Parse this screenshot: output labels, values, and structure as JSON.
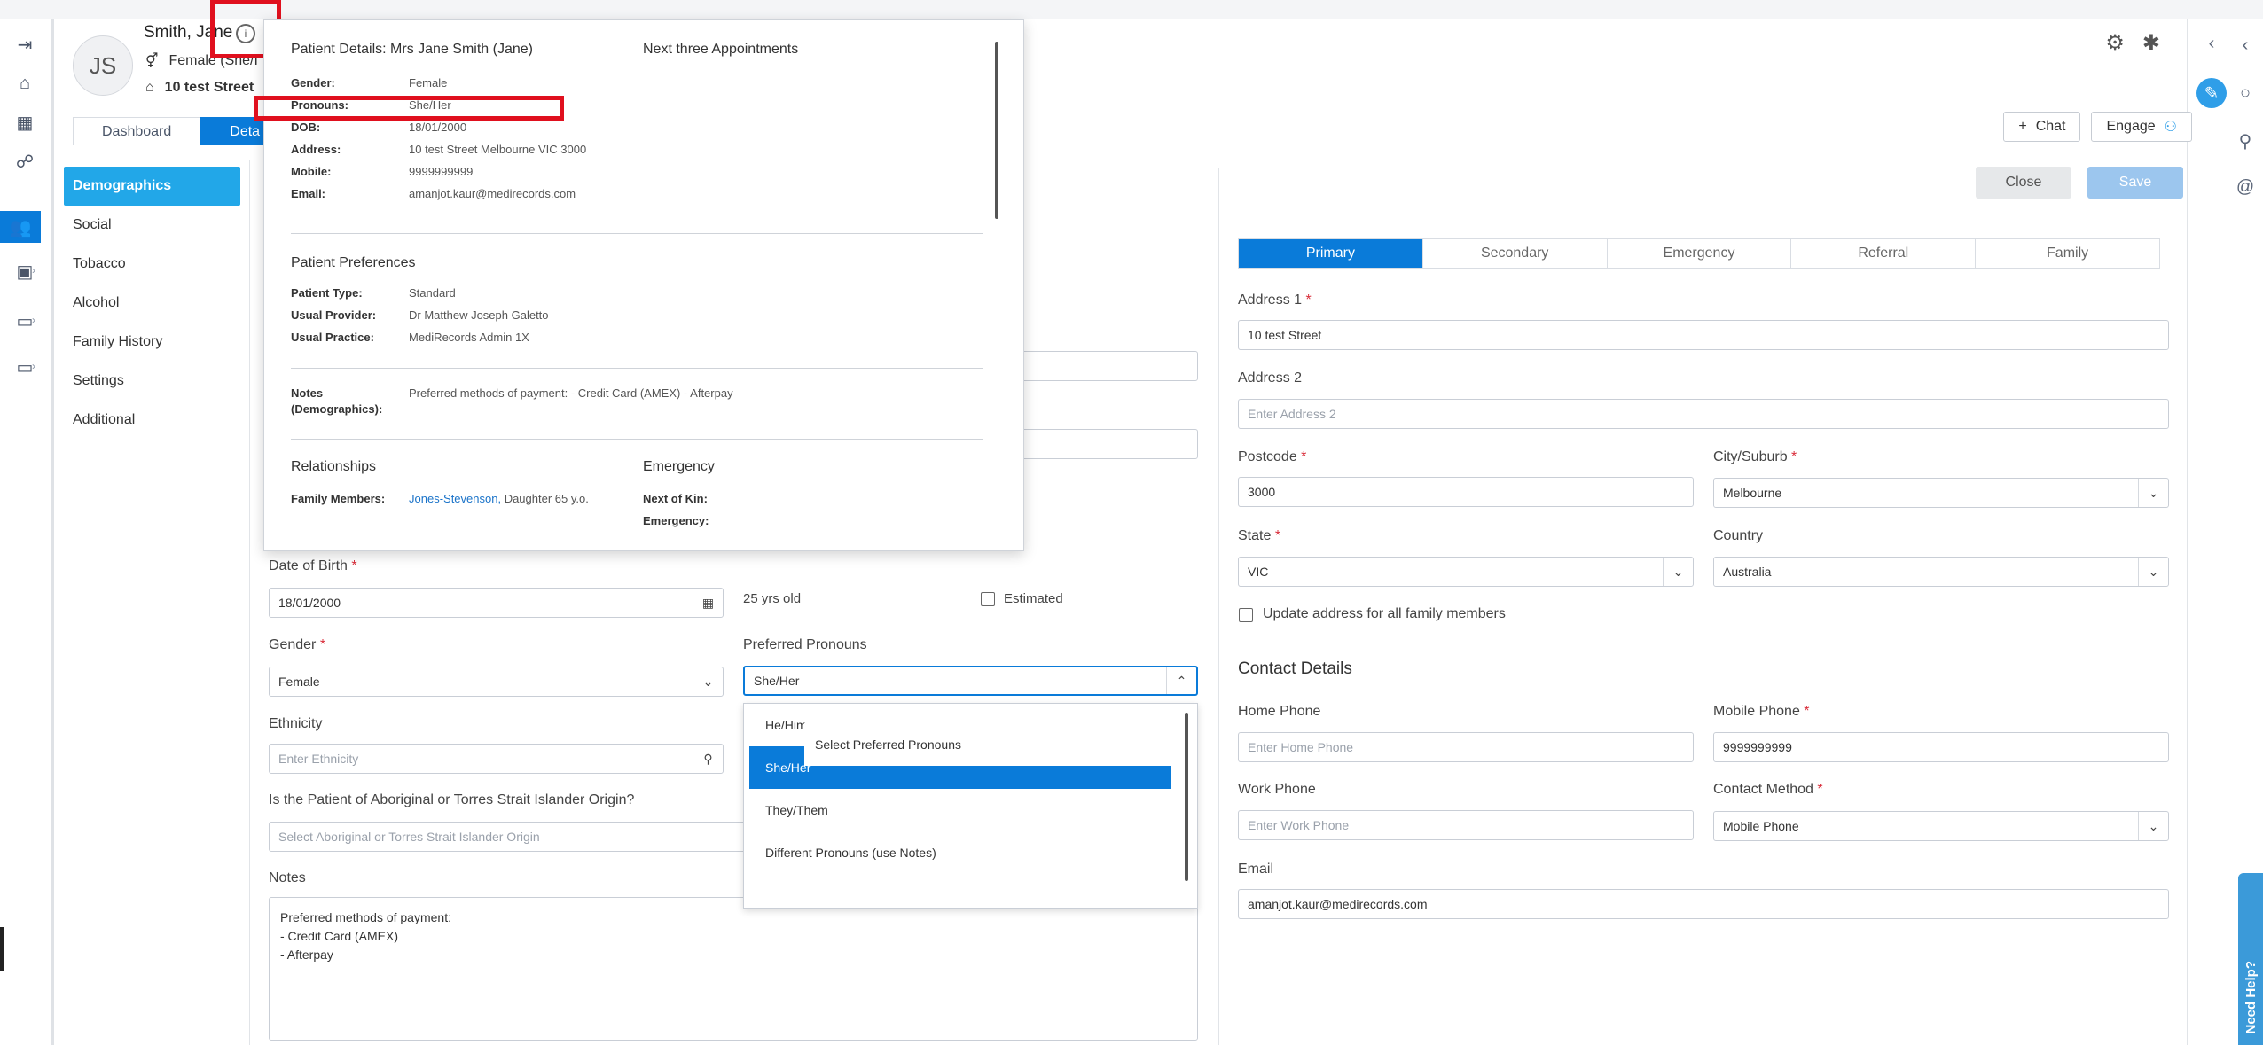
{
  "patient": {
    "name": "Smith, Jane",
    "initials": "JS",
    "gender_line": "Female (She/I",
    "address_line": "10 test Street"
  },
  "tabs": {
    "dashboard": "Dashboard",
    "details": "Deta"
  },
  "header_buttons": {
    "chat": "Chat",
    "engage": "Engage"
  },
  "actions": {
    "close": "Close",
    "save": "Save"
  },
  "sidenav": [
    "Demographics",
    "Social",
    "Tobacco",
    "Alcohol",
    "Family History",
    "Settings",
    "Additional"
  ],
  "popover": {
    "title": "Patient Details: Mrs Jane Smith (Jane)",
    "appointments_title": "Next three Appointments",
    "details": [
      {
        "k": "Gender:",
        "v": "Female"
      },
      {
        "k": "Pronouns:",
        "v": "She/Her"
      },
      {
        "k": "DOB:",
        "v": "18/01/2000"
      },
      {
        "k": "Address:",
        "v": "10 test Street Melbourne VIC 3000"
      },
      {
        "k": "Mobile:",
        "v": "9999999999"
      },
      {
        "k": "Email:",
        "v": "amanjot.kaur@medirecords.com"
      }
    ],
    "preferences_title": "Patient Preferences",
    "preferences": [
      {
        "k": "Patient Type:",
        "v": "Standard"
      },
      {
        "k": "Usual Provider:",
        "v": "Dr Matthew Joseph Galetto"
      },
      {
        "k": "Usual Practice:",
        "v": "MediRecords Admin 1X"
      }
    ],
    "notes_k1": "Notes",
    "notes_k2": "(Demographics):",
    "notes_v": "Preferred methods of payment: - Credit Card (AMEX) - Afterpay",
    "relationships_title": "Relationships",
    "family_k": "Family Members:",
    "family_link": "Jones-Stevenson,",
    "family_rest": " Daughter 65 y.o.",
    "emergency_title": "Emergency",
    "next_of_kin": "Next of Kin:",
    "emergency": "Emergency:"
  },
  "form": {
    "dob_label": "Date of Birth",
    "dob_value": "18/01/2000",
    "age": "25 yrs old",
    "estimated": "Estimated",
    "gender_label": "Gender",
    "gender_value": "Female",
    "pronouns_label": "Preferred Pronouns",
    "pronouns_value": "She/Her",
    "ethnicity_label": "Ethnicity",
    "ethnicity_placeholder": "Enter Ethnicity",
    "atsi_label": "Is the Patient of Aboriginal or Torres Strait Islander Origin?",
    "atsi_placeholder": "Select Aboriginal or Torres Strait Islander Origin",
    "notes_label": "Notes",
    "notes_value": "Preferred methods of payment:\n- Credit Card (AMEX)\n- Afterpay"
  },
  "pronoun_options": [
    "Select Preferred Pronouns",
    "He/Him",
    "She/Her",
    "They/Them",
    "Different Pronouns (use Notes)"
  ],
  "address_tabs": [
    "Primary",
    "Secondary",
    "Emergency",
    "Referral",
    "Family"
  ],
  "address": {
    "address1_label": "Address 1",
    "address1_value": "10 test Street",
    "address2_label": "Address 2",
    "address2_placeholder": "Enter Address 2",
    "postcode_label": "Postcode",
    "postcode_value": "3000",
    "city_label": "City/Suburb",
    "city_value": "Melbourne",
    "state_label": "State",
    "state_value": "VIC",
    "country_label": "Country",
    "country_value": "Australia",
    "update_family": "Update address for all family members"
  },
  "contact": {
    "title": "Contact Details",
    "home_label": "Home Phone",
    "home_placeholder": "Enter Home Phone",
    "mobile_label": "Mobile Phone",
    "mobile_value": "9999999999",
    "work_label": "Work Phone",
    "work_placeholder": "Enter Work Phone",
    "method_label": "Contact Method",
    "method_value": "Mobile Phone",
    "email_label": "Email",
    "email_value": "amanjot.kaur@medirecords.com"
  },
  "need_help": "Need Help?"
}
